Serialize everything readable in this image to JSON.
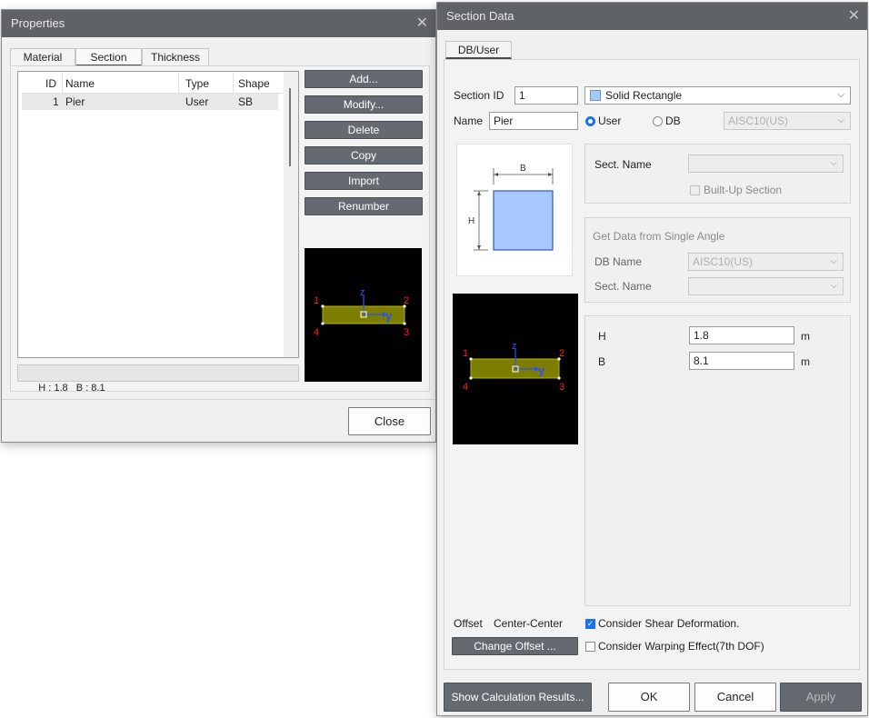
{
  "properties": {
    "title": "Properties",
    "tabs": [
      "Material",
      "Section",
      "Thickness"
    ],
    "table": {
      "headers": [
        "ID",
        "Name",
        "Type",
        "Shape"
      ],
      "rows": [
        [
          "1",
          "Pier",
          "User",
          "SB"
        ]
      ]
    },
    "buttons": [
      "Add...",
      "Modify...",
      "Delete",
      "Copy",
      "Import",
      "Renumber"
    ],
    "status": "H : 1.8   B : 8.1",
    "close_label": "Close",
    "preview": {
      "labels": [
        "1",
        "2",
        "3",
        "4"
      ],
      "axis_z": "z",
      "axis_y": "y"
    }
  },
  "section_data": {
    "title": "Section Data",
    "tab": "DB/User",
    "section_id_label": "Section ID",
    "section_id_value": "1",
    "shape_value": "Solid Rectangle",
    "name_label": "Name",
    "name_value": "Pier",
    "user_label": "User",
    "db_label": "DB",
    "db_value": "AISC10(US)",
    "sect_name_label": "Sect. Name",
    "built_up_label": "Built-Up Section",
    "single_angle_title": "Get Data from Single Angle",
    "db_name_label": "DB Name",
    "db_name_value": "AISC10(US)",
    "sect_name2_label": "Sect. Name",
    "diagram": {
      "b": "B",
      "h": "H"
    },
    "params": [
      {
        "label": "H",
        "value": "1.8",
        "unit": "m"
      },
      {
        "label": "B",
        "value": "8.1",
        "unit": "m"
      }
    ],
    "offset_label": "Offset",
    "offset_value": "Center-Center",
    "change_offset_label": "Change Offset ...",
    "shear_label": "Consider Shear Deformation.",
    "warping_label": "Consider Warping Effect(7th DOF)",
    "show_calc_label": "Show Calculation Results...",
    "ok_label": "OK",
    "cancel_label": "Cancel",
    "apply_label": "Apply",
    "preview": {
      "labels": [
        "1",
        "2",
        "3",
        "4"
      ],
      "axis_z": "z",
      "axis_y": "y"
    }
  },
  "colors": {
    "titlebar": "#5f6368",
    "section_fill": "#7d7d00",
    "shape_fill": "#a6c8ff",
    "accent": "#1a73e8"
  }
}
